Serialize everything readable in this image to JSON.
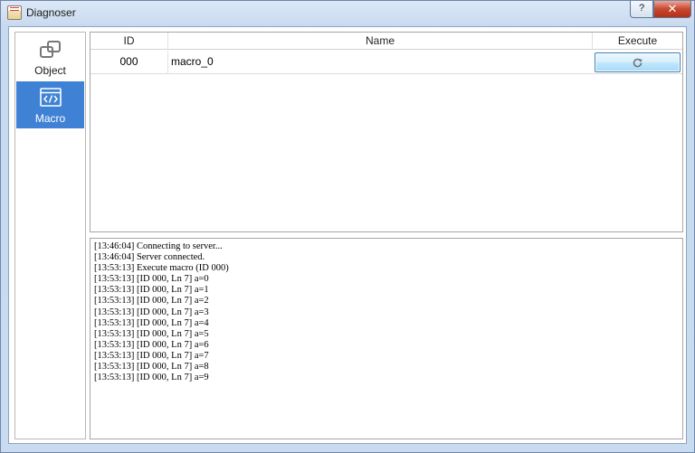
{
  "window": {
    "title": "Diagnoser",
    "help_label": "?",
    "close_label": "✕"
  },
  "sidebar": {
    "items": [
      {
        "label": "Object",
        "icon": "object-icon",
        "selected": false
      },
      {
        "label": "Macro",
        "icon": "macro-code-icon",
        "selected": true
      }
    ]
  },
  "table": {
    "columns": [
      "ID",
      "Name",
      "Execute"
    ],
    "rows": [
      {
        "id": "000",
        "name": "macro_0",
        "execute_icon": "run-refresh-icon"
      }
    ]
  },
  "log": {
    "lines": [
      "[13:46:04] Connecting to server...",
      "[13:46:04] Server connected.",
      "[13:53:13] Execute macro (ID 000)",
      "[13:53:13] [ID 000, Ln 7] a=0",
      "[13:53:13] [ID 000, Ln 7] a=1",
      "[13:53:13] [ID 000, Ln 7] a=2",
      "[13:53:13] [ID 000, Ln 7] a=3",
      "[13:53:13] [ID 000, Ln 7] a=4",
      "[13:53:13] [ID 000, Ln 7] a=5",
      "[13:53:13] [ID 000, Ln 7] a=6",
      "[13:53:13] [ID 000, Ln 7] a=7",
      "[13:53:13] [ID 000, Ln 7] a=8",
      "[13:53:13] [ID 000, Ln 7] a=9"
    ]
  },
  "colors": {
    "selected_bg": "#3f82d5",
    "titlebar": "#c9dbf1",
    "close_button": "#c9462f"
  }
}
